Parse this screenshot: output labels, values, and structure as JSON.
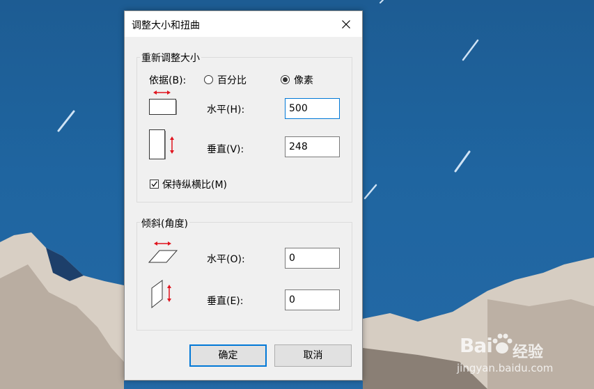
{
  "dialog": {
    "title": "调整大小和扭曲",
    "resize": {
      "group_label": "重新调整大小",
      "by_label": "依据(B):",
      "options": [
        {
          "label": "百分比",
          "checked": false
        },
        {
          "label": "像素",
          "checked": true
        }
      ],
      "horizontal_label": "水平(H):",
      "horizontal_value": "500",
      "vertical_label": "垂直(V):",
      "vertical_value": "248",
      "keep_ratio_label": "保持纵横比(M)",
      "keep_ratio_checked": true
    },
    "skew": {
      "group_label": "倾斜(角度)",
      "horizontal_label": "水平(O):",
      "horizontal_value": "0",
      "vertical_label": "垂直(E):",
      "vertical_value": "0"
    },
    "ok_label": "确定",
    "cancel_label": "取消"
  },
  "watermark": {
    "logo": "Bai",
    "logo_suffix": "经验",
    "url": "jingyan.baidu.com"
  },
  "colors": {
    "accent": "#0078d7",
    "arrow_red": "#e0141e",
    "sky": "#1f65a0"
  },
  "icons": [
    "close-icon",
    "resize-horizontal-icon",
    "resize-vertical-icon",
    "skew-horizontal-icon",
    "skew-vertical-icon",
    "check-icon"
  ]
}
